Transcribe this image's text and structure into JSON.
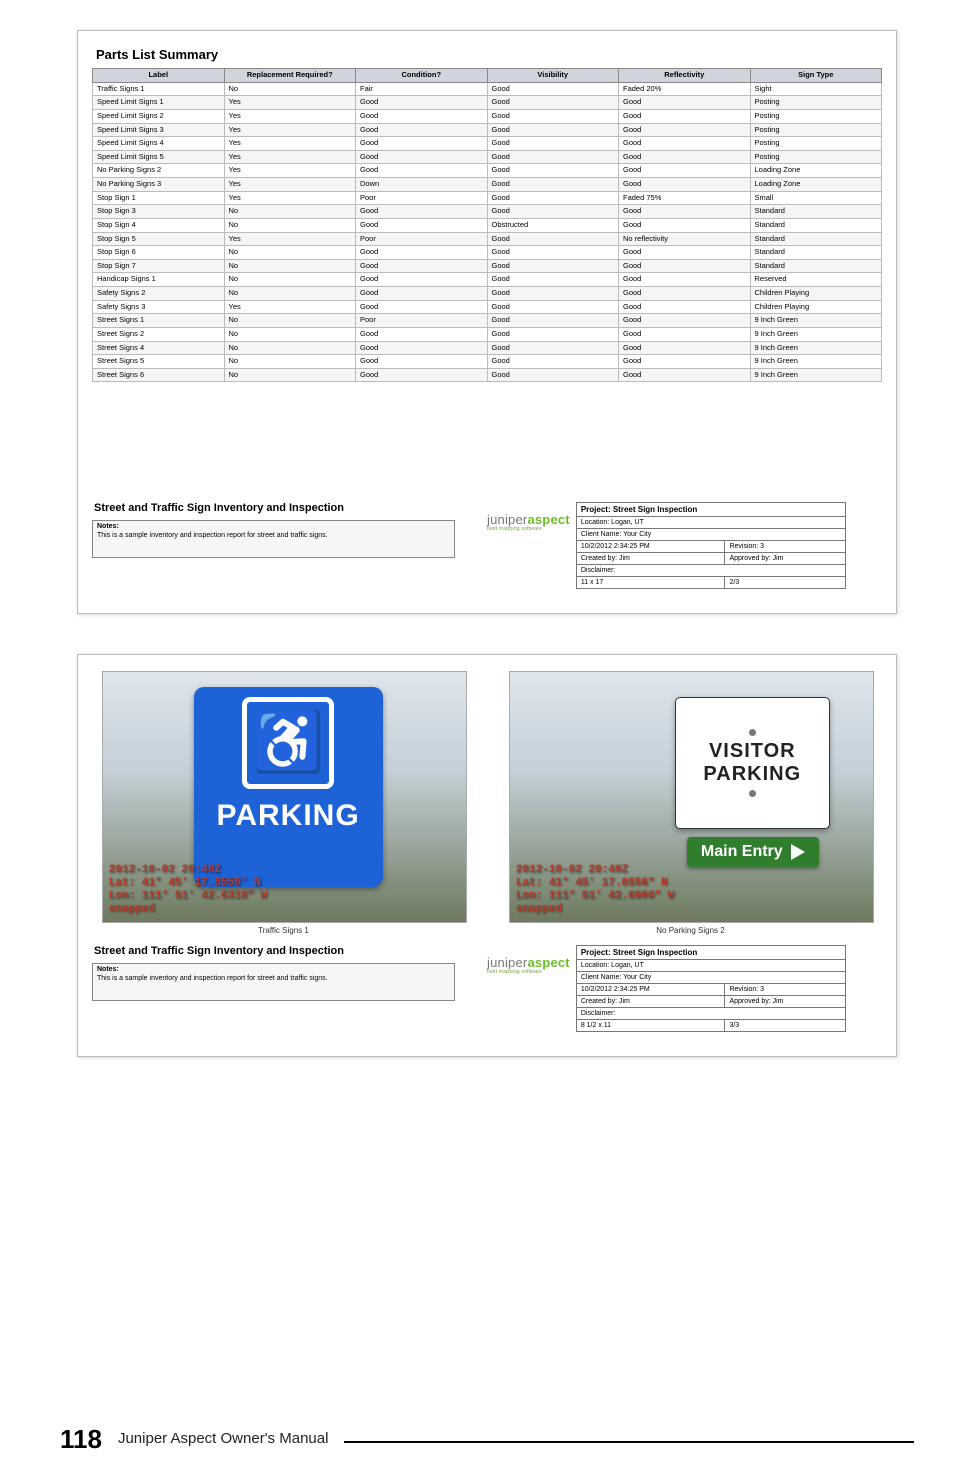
{
  "footer": {
    "page_number": "118",
    "doc_title": "Juniper Aspect Owner's Manual"
  },
  "panel1": {
    "heading": "Parts List Summary",
    "columns": [
      "Label",
      "Replacement Required?",
      "Condition?",
      "Visibility",
      "Reflectivity",
      "Sign Type"
    ],
    "rows": [
      [
        "Traffic Signs 1",
        "No",
        "Fair",
        "Good",
        "Faded 20%",
        "Sight"
      ],
      [
        "Speed Limit Signs 1",
        "Yes",
        "Good",
        "Good",
        "Good",
        "Posting"
      ],
      [
        "Speed Limit Signs 2",
        "Yes",
        "Good",
        "Good",
        "Good",
        "Posting"
      ],
      [
        "Speed Limit Signs 3",
        "Yes",
        "Good",
        "Good",
        "Good",
        "Posting"
      ],
      [
        "Speed Limit Signs 4",
        "Yes",
        "Good",
        "Good",
        "Good",
        "Posting"
      ],
      [
        "Speed Limit Signs 5",
        "Yes",
        "Good",
        "Good",
        "Good",
        "Posting"
      ],
      [
        "No Parking Signs 2",
        "Yes",
        "Good",
        "Good",
        "Good",
        "Loading Zone"
      ],
      [
        "No Parking Signs 3",
        "Yes",
        "Down",
        "Good",
        "Good",
        "Loading Zone"
      ],
      [
        "Stop Sign 1",
        "Yes",
        "Poor",
        "Good",
        "Faded 75%",
        "Small"
      ],
      [
        "Stop Sign 3",
        "No",
        "Good",
        "Good",
        "Good",
        "Standard"
      ],
      [
        "Stop Sign 4",
        "No",
        "Good",
        "Obstructed",
        "Good",
        "Standard"
      ],
      [
        "Stop Sign 5",
        "Yes",
        "Poor",
        "Good",
        "No reflectivity",
        "Standard"
      ],
      [
        "Stop Sign 6",
        "No",
        "Good",
        "Good",
        "Good",
        "Standard"
      ],
      [
        "Stop Sign 7",
        "No",
        "Good",
        "Good",
        "Good",
        "Standard"
      ],
      [
        "Handicap Signs 1",
        "No",
        "Good",
        "Good",
        "Good",
        "Reserved"
      ],
      [
        "Safety Signs 2",
        "No",
        "Good",
        "Good",
        "Good",
        "Children Playing"
      ],
      [
        "Safety Signs 3",
        "Yes",
        "Good",
        "Good",
        "Good",
        "Children Playing"
      ],
      [
        "Street Signs 1",
        "No",
        "Poor",
        "Good",
        "Good",
        "9 Inch Green"
      ],
      [
        "Street Signs 2",
        "No",
        "Good",
        "Good",
        "Good",
        "9 Inch Green"
      ],
      [
        "Street Signs 4",
        "No",
        "Good",
        "Good",
        "Good",
        "9 Inch Green"
      ],
      [
        "Street Signs 5",
        "No",
        "Good",
        "Good",
        "Good",
        "9 Inch Green"
      ],
      [
        "Street Signs 6",
        "No",
        "Good",
        "Good",
        "Good",
        "9 Inch Green"
      ]
    ],
    "report_title": "Street and Traffic Sign Inventory and Inspection",
    "notes_label": "Notes:",
    "notes_text": "This is a sample inventory and inspection report for street and traffic signs.",
    "logo_a": "juniper",
    "logo_b": "aspect",
    "logo_sub": "field mapping software",
    "meta_header": "Project: Street Sign Inspection",
    "meta_rows": [
      [
        "Location: Logan, UT",
        ""
      ],
      [
        "Client Name: Your City",
        ""
      ],
      [
        "10/2/2012 2:34:25 PM",
        "Revision: 3"
      ],
      [
        "Created by: Jim",
        "Approved by: Jim"
      ],
      [
        "Disclaimer:",
        ""
      ],
      [
        "11 x 17",
        "2/3"
      ]
    ]
  },
  "panel2": {
    "photo1": {
      "captionsign1": "PARKING",
      "stamp": "2012-10-02 20:48Z\nLat: 41° 45' 17.6556\" N\nLon: 111° 51' 42.6318\" W\nsnapped",
      "caption": "Traffic Signs 1"
    },
    "photo2": {
      "sign_word1": "VISITOR",
      "sign_word2": "PARKING",
      "sign_green": "Main Entry",
      "stamp": "2012-10-02 20:48Z\nLat: 41° 45' 17.6556\" N\nLon: 111° 51' 42.6900\" W\nsnapped",
      "caption": "No Parking Signs 2"
    },
    "report_title": "Street and Traffic Sign Inventory and Inspection",
    "notes_label": "Notes:",
    "notes_text": "This is a sample inventory and inspection report for street and traffic signs.",
    "logo_a": "juniper",
    "logo_b": "aspect",
    "logo_sub": "field mapping software",
    "meta_header": "Project: Street Sign Inspection",
    "meta_rows": [
      [
        "Location: Logan, UT",
        ""
      ],
      [
        "Client Name: Your City",
        ""
      ],
      [
        "10/2/2012 2:34:25 PM",
        "Revision: 3"
      ],
      [
        "Created by: Jim",
        "Approved by: Jim"
      ],
      [
        "Disclaimer:",
        ""
      ],
      [
        "8 1/2 x 11",
        "3/3"
      ]
    ]
  }
}
